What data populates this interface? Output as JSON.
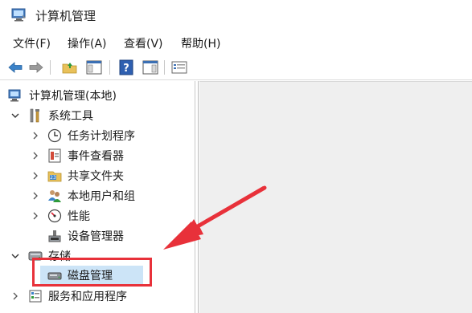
{
  "window": {
    "title": "计算机管理",
    "icon": "computer-management-icon"
  },
  "menu": [
    {
      "label": "文件(F)"
    },
    {
      "label": "操作(A)"
    },
    {
      "label": "查看(V)"
    },
    {
      "label": "帮助(H)"
    }
  ],
  "toolbar": {
    "buttons": [
      "back-arrow-icon",
      "forward-arrow-icon",
      "up-folder-icon",
      "show-hide-tree-icon",
      "help-icon",
      "show-action-pane-icon",
      "properties-icon"
    ]
  },
  "tree": {
    "root": {
      "label": "计算机管理(本地)",
      "icon": "computer-management-icon"
    },
    "system_tools": {
      "label": "系统工具",
      "icon": "tools-icon",
      "expanded": true
    },
    "task_scheduler": {
      "label": "任务计划程序",
      "icon": "clock-icon"
    },
    "event_viewer": {
      "label": "事件查看器",
      "icon": "event-log-icon"
    },
    "shared_folders": {
      "label": "共享文件夹",
      "icon": "shared-folder-icon"
    },
    "local_users": {
      "label": "本地用户和组",
      "icon": "users-icon"
    },
    "performance": {
      "label": "性能",
      "icon": "gauge-icon"
    },
    "device_manager": {
      "label": "设备管理器",
      "icon": "device-icon"
    },
    "storage": {
      "label": "存储",
      "icon": "storage-icon",
      "expanded": true
    },
    "disk_management": {
      "label": "磁盘管理",
      "icon": "disk-icon",
      "selected": true
    },
    "services_apps": {
      "label": "服务和应用程序",
      "icon": "services-icon"
    }
  },
  "colors": {
    "highlight_border": "#e8313a",
    "selection_bg": "#cce4f7",
    "content_bg": "#efefef"
  }
}
